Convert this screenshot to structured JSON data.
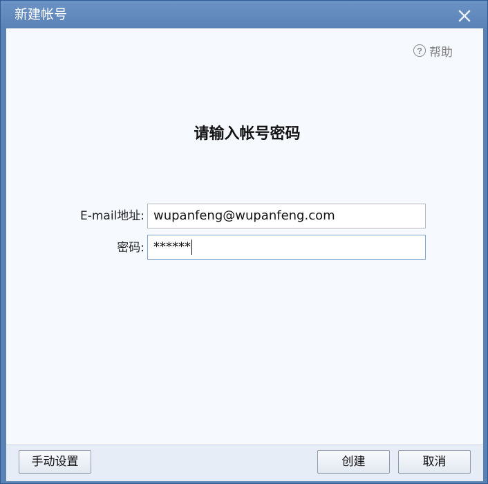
{
  "window": {
    "title": "新建帐号",
    "close_icon": "close-icon"
  },
  "help": {
    "icon": "question-circle-icon",
    "label": "帮助"
  },
  "form": {
    "heading": "请输入帐号密码",
    "email_label": "E-mail地址:",
    "email_value": "wupanfeng@wupanfeng.com",
    "password_label": "密码:",
    "password_value": "******"
  },
  "footer": {
    "manual_settings_label": "手动设置",
    "create_label": "创建",
    "cancel_label": "取消"
  },
  "colors": {
    "titlebar": "#5b82b5",
    "content_bg": "#f6f9fd",
    "footer_bg": "#e6edf7"
  }
}
